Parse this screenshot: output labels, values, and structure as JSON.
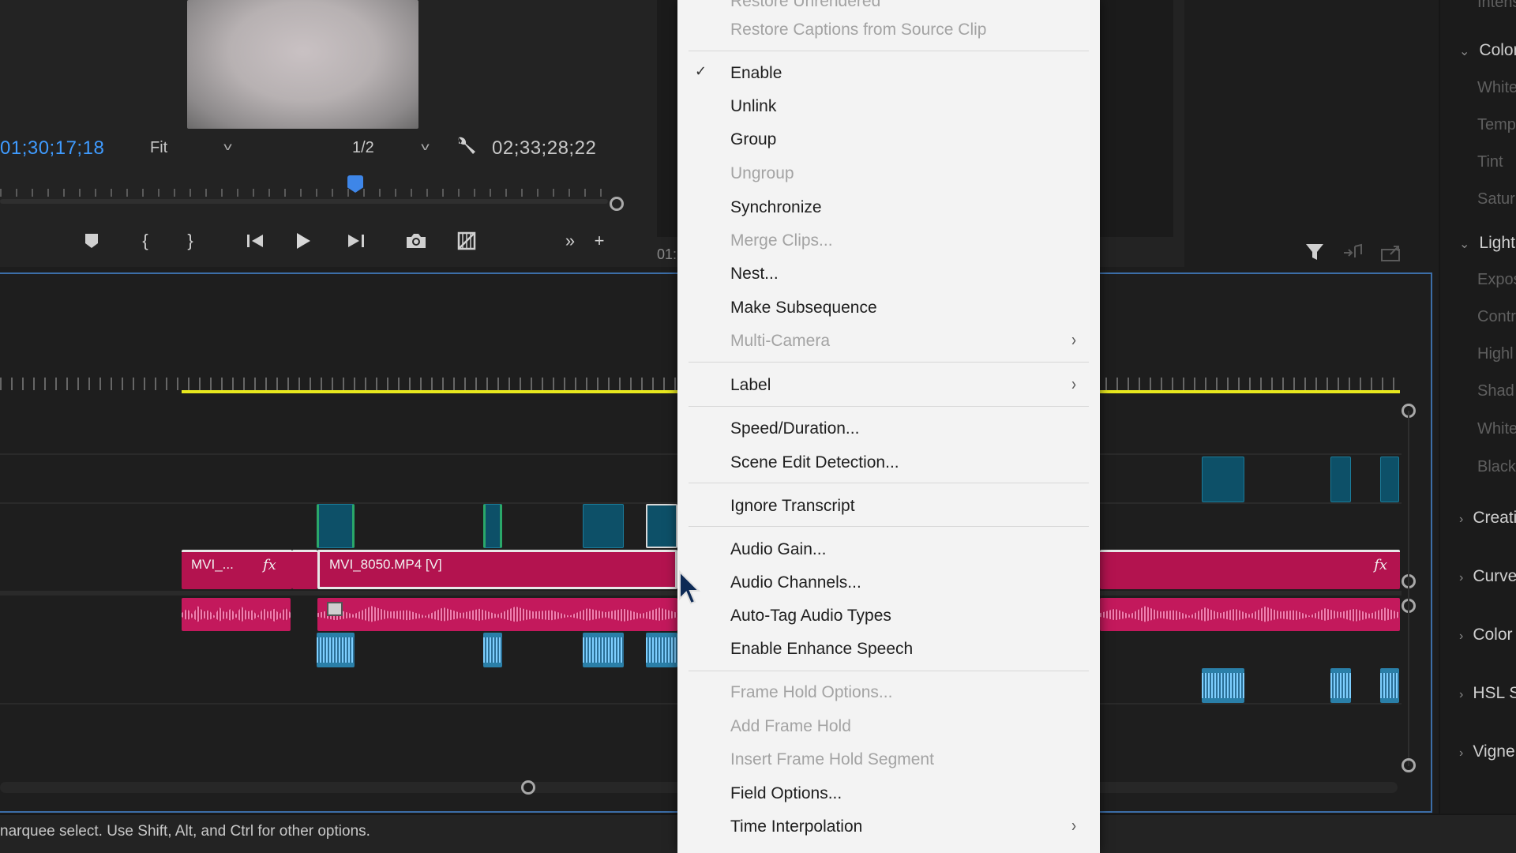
{
  "monitor": {
    "timecode_left": "01;30;17;18",
    "fit_label": "Fit",
    "resolution_label": "1/2",
    "timecode_right": "02;33;28;22"
  },
  "source": {
    "timecode": "01:"
  },
  "timeline": {
    "clip_small_label": "MVI_...",
    "clip_main_label": "MVI_8050.MP4 [V]",
    "fx_label": "fx"
  },
  "lumetri": {
    "items": [
      {
        "label": "Intens",
        "type": "sub"
      },
      {
        "label": "Color",
        "type": "head"
      },
      {
        "label": "White",
        "type": "sub"
      },
      {
        "label": "Temp",
        "type": "sub"
      },
      {
        "label": "Tint",
        "type": "sub"
      },
      {
        "label": "Satur",
        "type": "sub"
      },
      {
        "label": "Light",
        "type": "head"
      },
      {
        "label": "Expos",
        "type": "sub"
      },
      {
        "label": "Contr",
        "type": "sub"
      },
      {
        "label": "Highl",
        "type": "sub"
      },
      {
        "label": "Shad",
        "type": "sub"
      },
      {
        "label": "White",
        "type": "sub"
      },
      {
        "label": "Black",
        "type": "sub"
      },
      {
        "label": "Creati",
        "type": "sec"
      },
      {
        "label": "Curve",
        "type": "sec"
      },
      {
        "label": "Color",
        "type": "sec"
      },
      {
        "label": "HSL S",
        "type": "sec"
      },
      {
        "label": "Vigne",
        "type": "sec"
      }
    ]
  },
  "status": {
    "text": "narquee select. Use Shift, Alt, and Ctrl for other options."
  },
  "menu": {
    "items": [
      {
        "label": "Restore Unrendered",
        "enabled": false
      },
      {
        "label": "Restore Captions from Source Clip",
        "enabled": false
      },
      {
        "label": "Enable",
        "enabled": true,
        "checked": true
      },
      {
        "label": "Unlink",
        "enabled": true
      },
      {
        "label": "Group",
        "enabled": true
      },
      {
        "label": "Ungroup",
        "enabled": false
      },
      {
        "label": "Synchronize",
        "enabled": true
      },
      {
        "label": "Merge Clips...",
        "enabled": false
      },
      {
        "label": "Nest...",
        "enabled": true
      },
      {
        "label": "Make Subsequence",
        "enabled": true
      },
      {
        "label": "Multi-Camera",
        "enabled": false,
        "submenu": true
      },
      {
        "label": "Label",
        "enabled": true,
        "submenu": true
      },
      {
        "label": "Speed/Duration...",
        "enabled": true
      },
      {
        "label": "Scene Edit Detection...",
        "enabled": true
      },
      {
        "label": "Ignore Transcript",
        "enabled": true
      },
      {
        "label": "Audio Gain...",
        "enabled": true
      },
      {
        "label": "Audio Channels...",
        "enabled": true
      },
      {
        "label": "Auto-Tag Audio Types",
        "enabled": true
      },
      {
        "label": "Enable Enhance Speech",
        "enabled": true
      },
      {
        "label": "Frame Hold Options...",
        "enabled": false
      },
      {
        "label": "Add Frame Hold",
        "enabled": false
      },
      {
        "label": "Insert Frame Hold Segment",
        "enabled": false
      },
      {
        "label": "Field Options...",
        "enabled": true
      },
      {
        "label": "Time Interpolation",
        "enabled": true,
        "submenu": true
      }
    ]
  },
  "colors": {
    "accent_timecode": "#3f9bff",
    "clip_video": "#b3134f",
    "clip_audio": "#c3195c",
    "work_area": "#e8e81e",
    "menu_bg": "#f3f3f3"
  }
}
